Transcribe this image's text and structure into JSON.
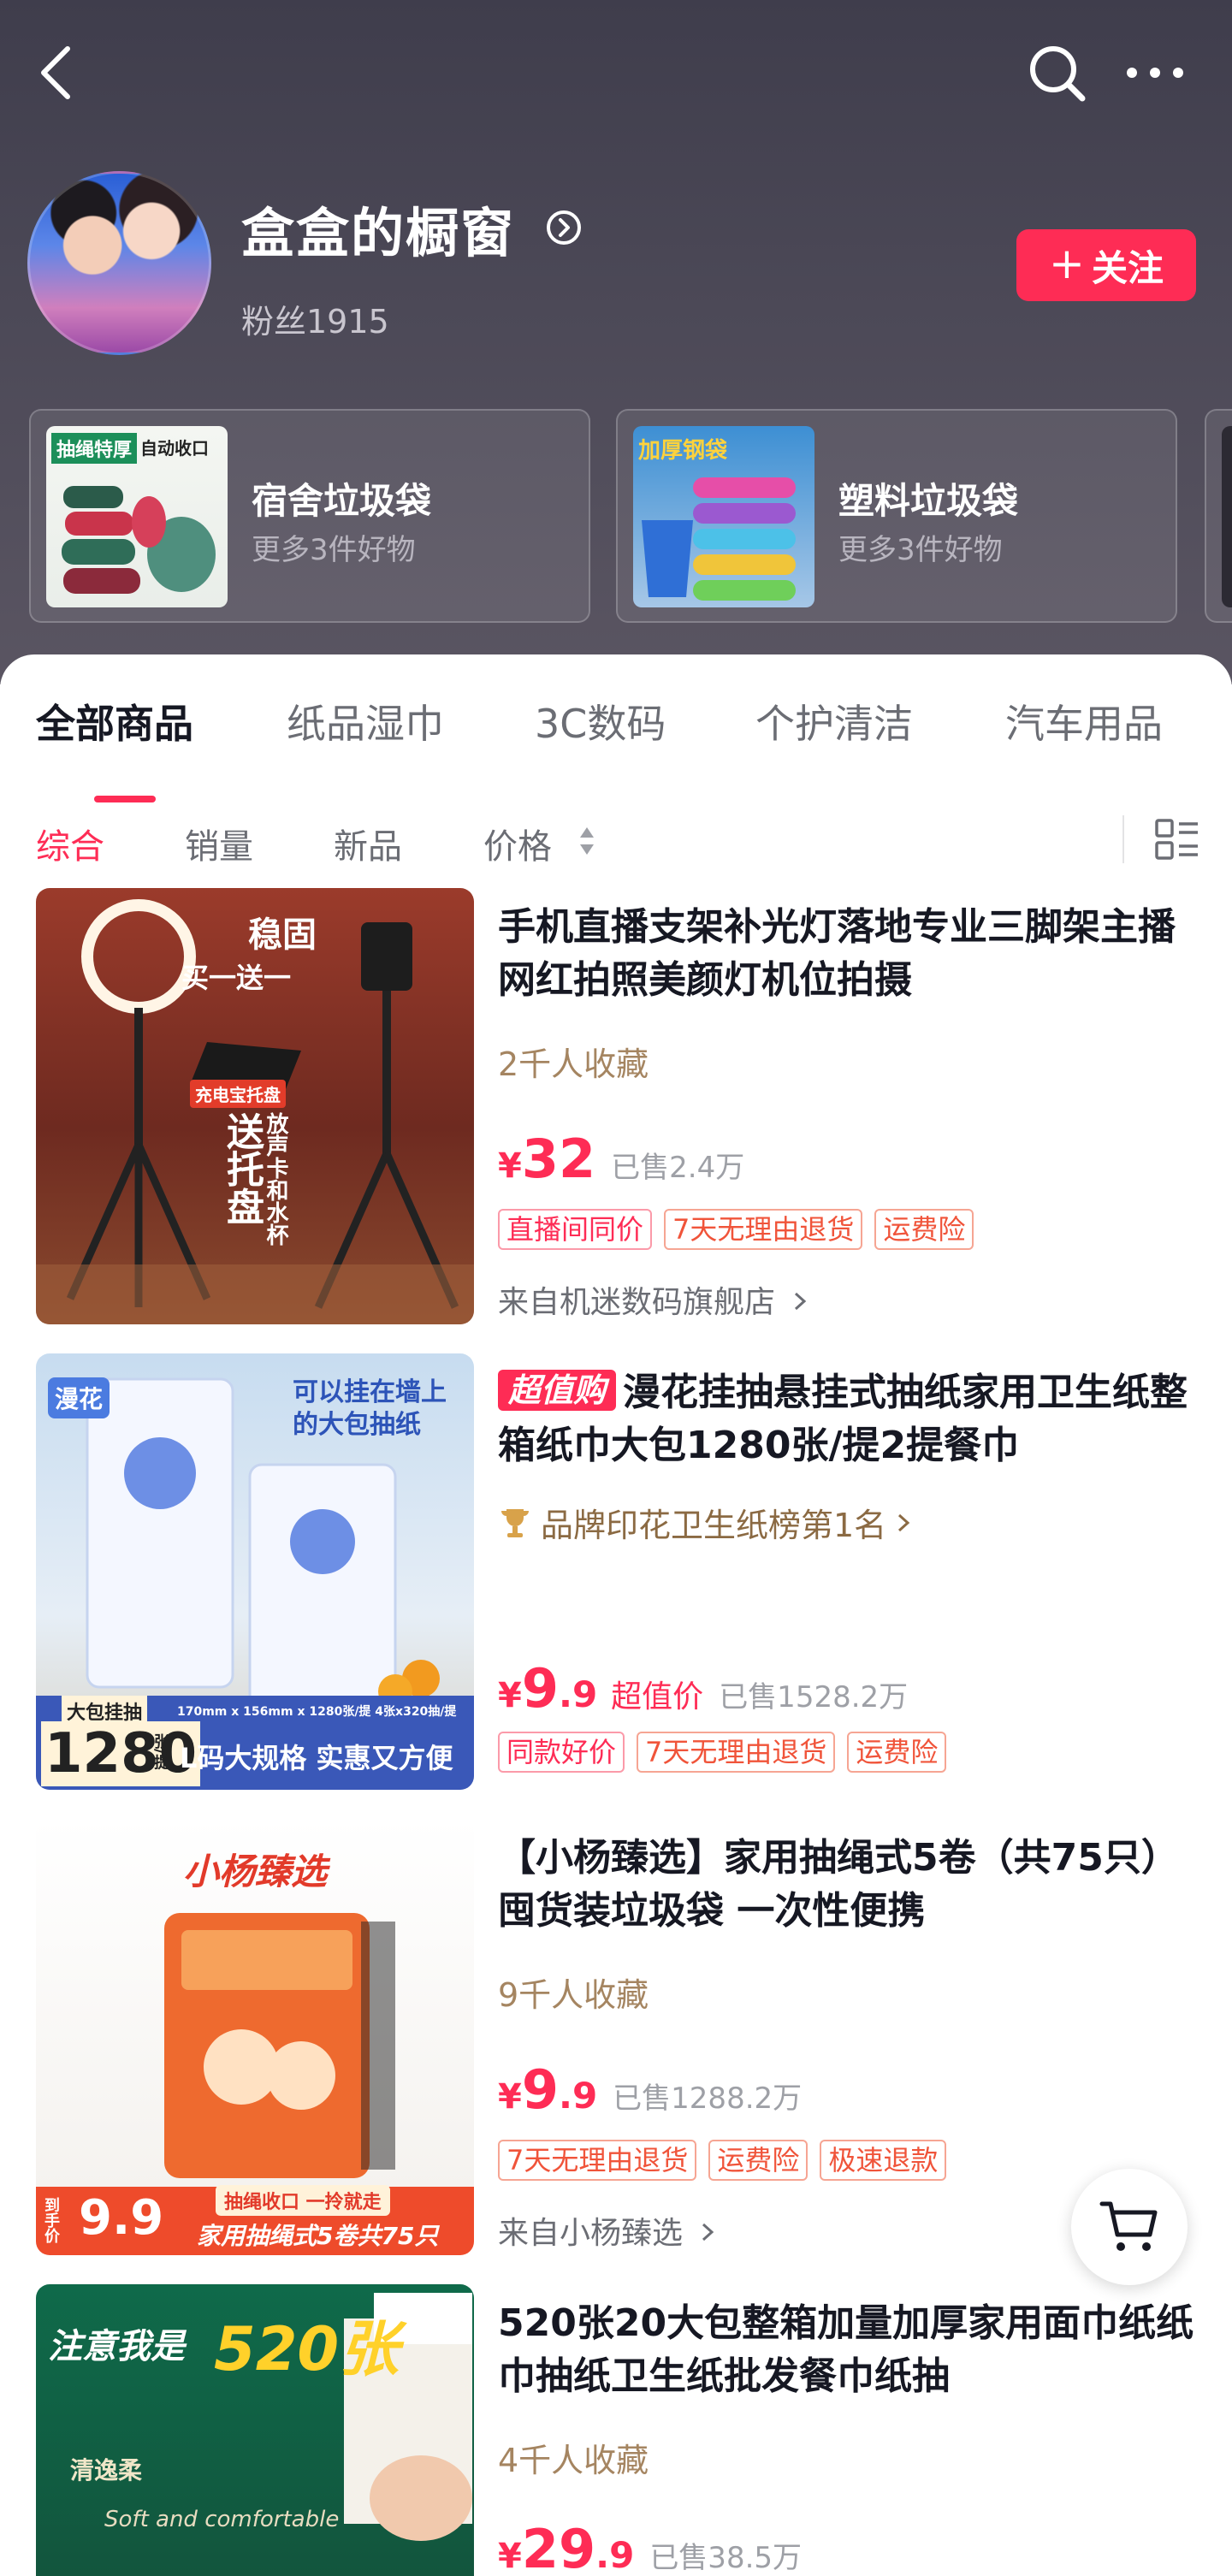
{
  "header": {
    "shop_name": "盒盒的橱窗",
    "fans": "粉丝1915",
    "follow_label": "关注",
    "follow_plus": "+"
  },
  "categories": [
    {
      "name": "宿舍垃圾袋",
      "more": "更多3件好物",
      "thumb_text_1": "抽绳特厚",
      "thumb_text_2": "自动收口"
    },
    {
      "name": "塑料垃圾袋",
      "more": "更多3件好物",
      "thumb_text_1": "加厚钢袋"
    }
  ],
  "tabs": [
    "全部商品",
    "纸品湿巾",
    "3C数码",
    "个护清洁",
    "汽车用品"
  ],
  "sorts": [
    "综合",
    "销量",
    "新品",
    "价格"
  ],
  "products": [
    {
      "title": "手机直播支架补光灯落地专业三脚架主播网红拍照美颜灯机位拍摄",
      "favorites": "2千人收藏",
      "yen": "¥",
      "price_int": "32",
      "price_dec": "",
      "sold": "已售2.4万",
      "tags": [
        "直播间同价",
        "7天无理由退货",
        "运费险"
      ],
      "shop": "来自机迷数码旗舰店",
      "img_text": {
        "a": "稳固",
        "b": "买一送一",
        "c": "充电宝托盘",
        "d": "送托盘",
        "e": "放声卡和水杯"
      }
    },
    {
      "deal_badge": "超值购",
      "title": "漫花挂抽悬挂式抽纸家用卫生纸整箱纸巾大包1280张/提2提餐巾",
      "rank": "品牌印花卫生纸榜第1名",
      "yen": "¥",
      "price_int": "9",
      "price_dec": ".9",
      "price_tag": "超值价",
      "sold": "已售1528.2万",
      "tags": [
        "同款好价",
        "7天无理由退货",
        "运费险"
      ],
      "img_text": {
        "a": "漫花",
        "b": "可以挂在墙上",
        "c": "的大包抽纸",
        "d": "大包挂抽",
        "e": "1280",
        "f": "张/提",
        "g": "L码大规格 实惠又方便",
        "h": "170mm x 156mm x 1280张/提  4张x320抽/提"
      }
    },
    {
      "title": "【小杨臻选】家用抽绳式5卷（共75只）囤货装垃圾袋 一次性便携",
      "favorites": "9千人收藏",
      "yen": "¥",
      "price_int": "9",
      "price_dec": ".9",
      "sold": "已售1288.2万",
      "tags": [
        "7天无理由退货",
        "运费险",
        "极速退款"
      ],
      "shop": "来自小杨臻选",
      "img_text": {
        "a": "小杨臻选",
        "b": "到手价",
        "c": "9.9",
        "d": "抽绳收口 一拎就走",
        "e": "家用抽绳式5卷共75只"
      }
    },
    {
      "title": "520张20大包整箱加量加厚家用面巾纸纸巾抽纸卫生纸批发餐巾纸抽",
      "favorites": "4千人收藏",
      "yen": "¥",
      "price_int": "29",
      "price_dec": ".9",
      "sold": "已售38.5万",
      "img_text": {
        "a": "注意我是",
        "b": "520张",
        "c": "清逸柔",
        "d": "Soft and comfortable"
      }
    }
  ],
  "colors": {
    "accent": "#fe2c55",
    "header_bg": "#4a4754",
    "tag_orange": "#f0543a",
    "favorites": "#a58561"
  }
}
